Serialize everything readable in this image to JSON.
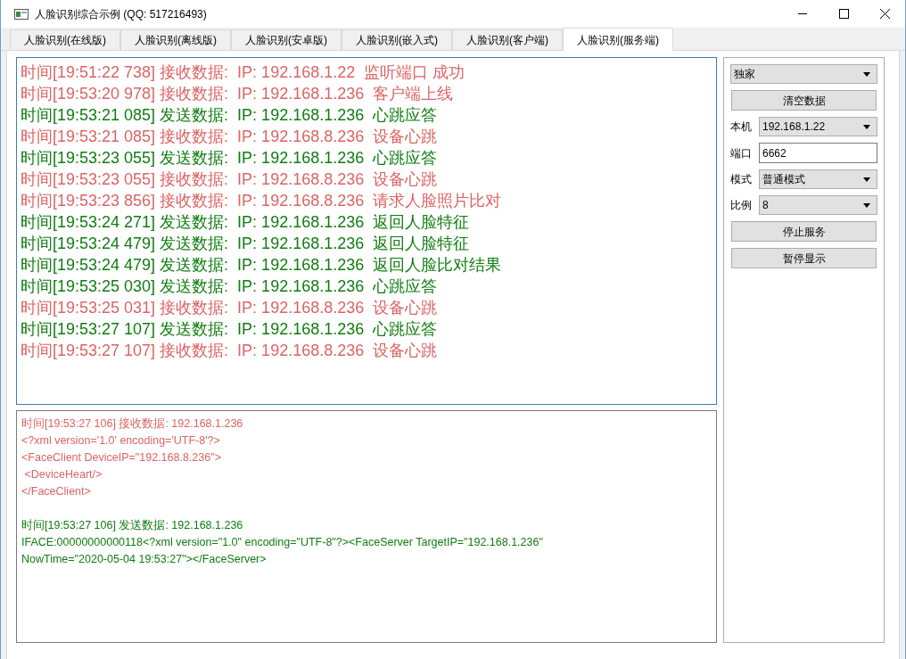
{
  "window": {
    "title": "人脸识别综合示例 (QQ: 517216493)"
  },
  "tabs": [
    {
      "label": "人脸识别(在线版)",
      "selected": false
    },
    {
      "label": "人脸识别(离线版)",
      "selected": false
    },
    {
      "label": "人脸识别(安卓版)",
      "selected": false
    },
    {
      "label": "人脸识别(嵌入式)",
      "selected": false
    },
    {
      "label": "人脸识别(客户端)",
      "selected": false
    },
    {
      "label": "人脸识别(服务端)",
      "selected": true
    }
  ],
  "log": [
    {
      "kind": "receive",
      "text": "时间[19:51:22 738] 接收数据:  IP: 192.168.1.22  监听端口 成功"
    },
    {
      "kind": "receive",
      "text": "时间[19:53:20 978] 接收数据:  IP: 192.168.1.236  客户端上线"
    },
    {
      "kind": "send",
      "text": "时间[19:53:21 085] 发送数据:  IP: 192.168.1.236  心跳应答"
    },
    {
      "kind": "receive",
      "text": "时间[19:53:21 085] 接收数据:  IP: 192.168.8.236  设备心跳"
    },
    {
      "kind": "send",
      "text": "时间[19:53:23 055] 发送数据:  IP: 192.168.1.236  心跳应答"
    },
    {
      "kind": "receive",
      "text": "时间[19:53:23 055] 接收数据:  IP: 192.168.8.236  设备心跳"
    },
    {
      "kind": "receive",
      "text": "时间[19:53:23 856] 接收数据:  IP: 192.168.8.236  请求人脸照片比对"
    },
    {
      "kind": "send",
      "text": "时间[19:53:24 271] 发送数据:  IP: 192.168.1.236  返回人脸特征"
    },
    {
      "kind": "send",
      "text": "时间[19:53:24 479] 发送数据:  IP: 192.168.1.236  返回人脸特征"
    },
    {
      "kind": "send",
      "text": "时间[19:53:24 479] 发送数据:  IP: 192.168.1.236  返回人脸比对结果"
    },
    {
      "kind": "send",
      "text": "时间[19:53:25 030] 发送数据:  IP: 192.168.1.236  心跳应答"
    },
    {
      "kind": "receive",
      "text": "时间[19:53:25 031] 接收数据:  IP: 192.168.8.236  设备心跳"
    },
    {
      "kind": "send",
      "text": "时间[19:53:27 107] 发送数据:  IP: 192.168.1.236  心跳应答"
    },
    {
      "kind": "receive",
      "text": "时间[19:53:27 107] 接收数据:  IP: 192.168.8.236  设备心跳"
    }
  ],
  "detail": [
    {
      "kind": "receive",
      "lines": [
        "时间[19:53:27 106] 接收数据: 192.168.1.236",
        "<?xml version='1.0' encoding='UTF-8'?>",
        "<FaceClient DeviceIP=\"192.168.8.236\">",
        " <DeviceHeart/>",
        "</FaceClient>"
      ]
    },
    {
      "kind": "send",
      "lines": [
        "时间[19:53:27 106] 发送数据: 192.168.1.236",
        "IFACE:00000000000118<?xml version=\"1.0\" encoding=\"UTF-8\"?><FaceServer TargetIP=\"192.168.1.236\"",
        "NowTime=\"2020-05-04 19:53:27\"></FaceServer>"
      ]
    }
  ],
  "controls": [
    {
      "kind": "select",
      "value": "独家"
    },
    {
      "kind": "button",
      "label": "清空数据"
    },
    {
      "kind": "select",
      "label": "本机",
      "value": "192.168.1.22"
    },
    {
      "kind": "input",
      "label": "端口",
      "value": "6662"
    },
    {
      "kind": "select",
      "label": "模式",
      "value": "普通模式"
    },
    {
      "kind": "select",
      "label": "比例",
      "value": "8"
    },
    {
      "kind": "button",
      "label": "停止服务"
    },
    {
      "kind": "button",
      "label": "暂停显示"
    }
  ]
}
